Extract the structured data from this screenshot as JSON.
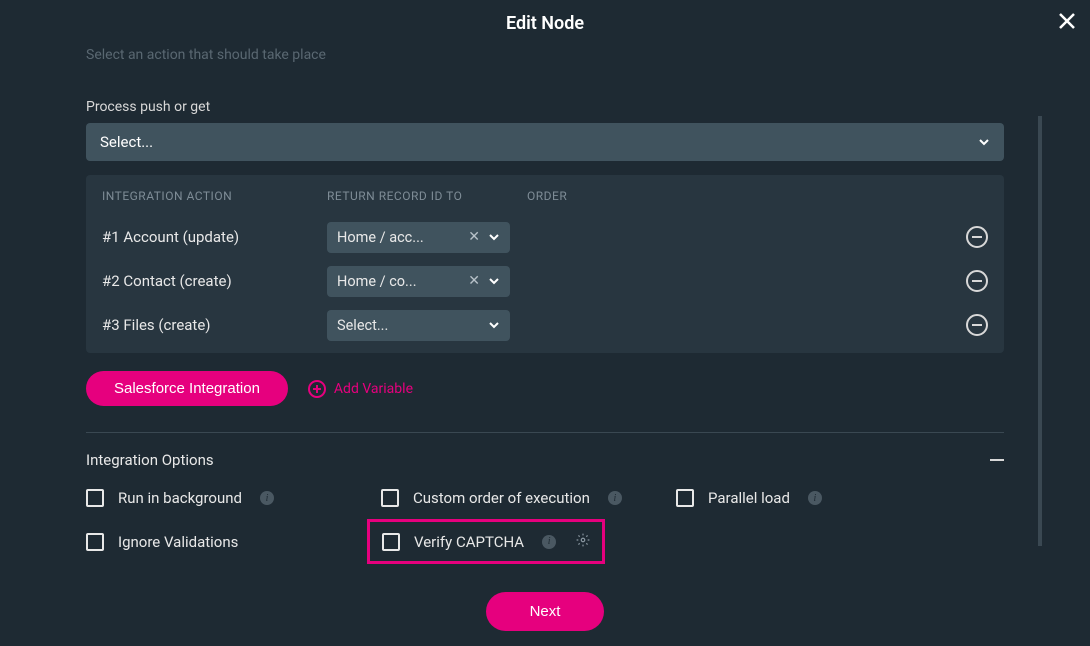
{
  "modal": {
    "title": "Edit Node",
    "subtitle": "Select an action that should take place"
  },
  "process": {
    "label": "Process push or get",
    "placeholder": "Select..."
  },
  "table": {
    "headers": {
      "action": "INTEGRATION ACTION",
      "return": "RETURN RECORD ID TO",
      "order": "ORDER"
    },
    "rows": [
      {
        "label": "#1 Account (update)",
        "return": "Home / acc...",
        "has_clear": true
      },
      {
        "label": "#2 Contact (create)",
        "return": "Home / co...",
        "has_clear": true
      },
      {
        "label": "#3 Files (create)",
        "return": "Select...",
        "has_clear": false
      }
    ]
  },
  "actions": {
    "integration_btn": "Salesforce Integration",
    "add_variable": "Add Variable"
  },
  "options": {
    "title": "Integration Options",
    "items": {
      "run_bg": "Run in background",
      "custom_order": "Custom order of execution",
      "parallel": "Parallel load",
      "ignore_val": "Ignore Validations",
      "verify_captcha": "Verify CAPTCHA"
    }
  },
  "footer": {
    "next": "Next"
  }
}
